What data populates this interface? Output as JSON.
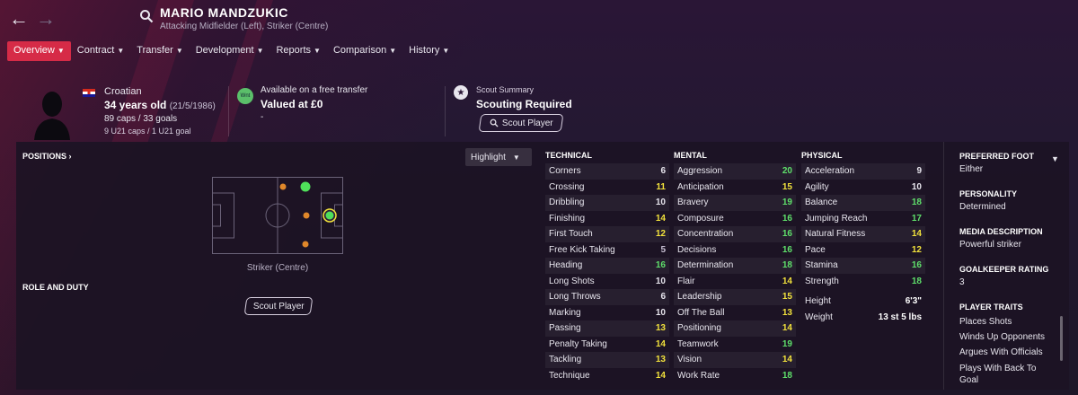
{
  "header": {
    "back_icon": "arrow-left-icon",
    "forward_icon": "arrow-right-icon",
    "search_icon": "search-icon",
    "player_name": "MARIO MANDZUKIC",
    "positions": "Attacking Midfielder (Left), Striker (Centre)"
  },
  "tabs": [
    {
      "label": "Overview",
      "active": true
    },
    {
      "label": "Contract",
      "active": false
    },
    {
      "label": "Transfer",
      "active": false
    },
    {
      "label": "Development",
      "active": false
    },
    {
      "label": "Reports",
      "active": false
    },
    {
      "label": "Comparison",
      "active": false
    },
    {
      "label": "History",
      "active": false
    }
  ],
  "info": {
    "nationality": "Croatian",
    "age": "34 years old",
    "dob": "(21/5/1986)",
    "caps": "89 caps / 33 goals",
    "u21": "9 U21 caps / 1 U21 goal",
    "wnt_badge": "Wnt",
    "availability": "Available on a free transfer",
    "valued": "Valued at £0",
    "valued_extra": "-",
    "scout_summary_label": "Scout Summary",
    "scout_summary_value": "Scouting Required",
    "scout_button": "Scout Player"
  },
  "positions_panel": {
    "title": "POSITIONS",
    "highlight_label": "Highlight",
    "pitch_caption": "Striker (Centre)",
    "role_title": "ROLE AND DUTY",
    "scout_button": "Scout Player"
  },
  "attributes": {
    "technical": {
      "title": "TECHNICAL",
      "rows": [
        {
          "name": "Corners",
          "value": 6
        },
        {
          "name": "Crossing",
          "value": 11
        },
        {
          "name": "Dribbling",
          "value": 10
        },
        {
          "name": "Finishing",
          "value": 14
        },
        {
          "name": "First Touch",
          "value": 12
        },
        {
          "name": "Free Kick Taking",
          "value": 5
        },
        {
          "name": "Heading",
          "value": 16
        },
        {
          "name": "Long Shots",
          "value": 10
        },
        {
          "name": "Long Throws",
          "value": 6
        },
        {
          "name": "Marking",
          "value": 10
        },
        {
          "name": "Passing",
          "value": 13
        },
        {
          "name": "Penalty Taking",
          "value": 14
        },
        {
          "name": "Tackling",
          "value": 13
        },
        {
          "name": "Technique",
          "value": 14
        }
      ]
    },
    "mental": {
      "title": "MENTAL",
      "rows": [
        {
          "name": "Aggression",
          "value": 20
        },
        {
          "name": "Anticipation",
          "value": 15
        },
        {
          "name": "Bravery",
          "value": 19
        },
        {
          "name": "Composure",
          "value": 16
        },
        {
          "name": "Concentration",
          "value": 16
        },
        {
          "name": "Decisions",
          "value": 16
        },
        {
          "name": "Determination",
          "value": 18
        },
        {
          "name": "Flair",
          "value": 14
        },
        {
          "name": "Leadership",
          "value": 15
        },
        {
          "name": "Off The Ball",
          "value": 13
        },
        {
          "name": "Positioning",
          "value": 14
        },
        {
          "name": "Teamwork",
          "value": 19
        },
        {
          "name": "Vision",
          "value": 14
        },
        {
          "name": "Work Rate",
          "value": 18
        }
      ]
    },
    "physical": {
      "title": "PHYSICAL",
      "rows": [
        {
          "name": "Acceleration",
          "value": 9
        },
        {
          "name": "Agility",
          "value": 10
        },
        {
          "name": "Balance",
          "value": 18
        },
        {
          "name": "Jumping Reach",
          "value": 17
        },
        {
          "name": "Natural Fitness",
          "value": 14
        },
        {
          "name": "Pace",
          "value": 12
        },
        {
          "name": "Stamina",
          "value": 16
        },
        {
          "name": "Strength",
          "value": 18
        }
      ],
      "height_label": "Height",
      "height_value": "6'3\"",
      "weight_label": "Weight",
      "weight_value": "13 st 5 lbs"
    }
  },
  "side": {
    "preferred_foot_label": "PREFERRED FOOT",
    "preferred_foot": "Either",
    "personality_label": "PERSONALITY",
    "personality": "Determined",
    "media_label": "MEDIA DESCRIPTION",
    "media": "Powerful striker",
    "gk_label": "GOALKEEPER RATING",
    "gk": "3",
    "traits_label": "PLAYER TRAITS",
    "traits": [
      "Places Shots",
      "Winds Up Opponents",
      "Argues With Officials",
      "Plays With Back To Goal"
    ]
  },
  "colors": {
    "accent": "#d62b47",
    "high": "#5fe06b",
    "good": "#9ce04a",
    "mid": "#f2e23c",
    "low": "#e8e6ee",
    "poor": "#c8c0d4"
  }
}
